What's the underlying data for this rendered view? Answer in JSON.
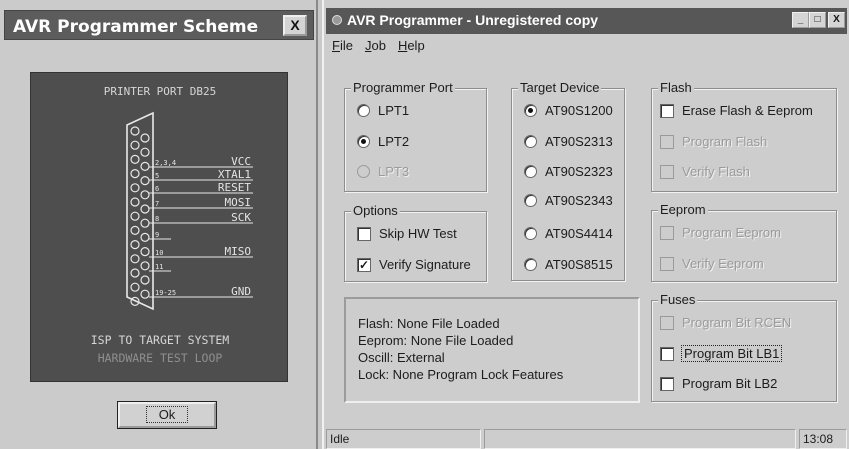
{
  "scheme_window": {
    "title": "AVR Programmer Scheme",
    "close_label": "X",
    "port_label": "PRINTER PORT DB25",
    "pin_labels": [
      {
        "num": "2,3,4",
        "name": "VCC"
      },
      {
        "num": "5",
        "name": "XTAL1"
      },
      {
        "num": "6",
        "name": "RESET"
      },
      {
        "num": "7",
        "name": "MOSI"
      },
      {
        "num": "8",
        "name": "SCK"
      },
      {
        "num": "9",
        "name": ""
      },
      {
        "num": "10",
        "name": "MISO"
      },
      {
        "num": "11",
        "name": ""
      },
      {
        "num": "19-25",
        "name": "GND"
      }
    ],
    "isp_label": "ISP TO TARGET SYSTEM",
    "hw_test_label": "HARDWARE TEST LOOP",
    "ok_label": "Ok"
  },
  "programmer_window": {
    "title": "AVR Programmer - Unregistered copy",
    "buttons": {
      "minimize": "_",
      "maximize": "□",
      "close": "X"
    },
    "menu": [
      "File",
      "Job",
      "Help"
    ],
    "programmer_port": {
      "label": "Programmer Port",
      "options": [
        {
          "label": "LPT1",
          "selected": false,
          "enabled": true
        },
        {
          "label": "LPT2",
          "selected": true,
          "enabled": true
        },
        {
          "label": "LPT3",
          "selected": false,
          "enabled": false
        }
      ]
    },
    "options": {
      "label": "Options",
      "items": [
        {
          "label": "Skip HW Test",
          "checked": false
        },
        {
          "label": "Verify Signature",
          "checked": true
        }
      ]
    },
    "target_device": {
      "label": "Target Device",
      "options": [
        {
          "label": "AT90S1200",
          "selected": true
        },
        {
          "label": "AT90S2313",
          "selected": false
        },
        {
          "label": "AT90S2323",
          "selected": false
        },
        {
          "label": "AT90S2343",
          "selected": false
        },
        {
          "label": "AT90S4414",
          "selected": false
        },
        {
          "label": "AT90S8515",
          "selected": false
        }
      ]
    },
    "flash": {
      "label": "Flash",
      "items": [
        {
          "label": "Erase Flash & Eeprom",
          "enabled": true
        },
        {
          "label": "Program Flash",
          "enabled": false
        },
        {
          "label": "Verify Flash",
          "enabled": false
        }
      ]
    },
    "eeprom": {
      "label": "Eeprom",
      "items": [
        {
          "label": "Program Eeprom",
          "enabled": false
        },
        {
          "label": "Verify Eeprom",
          "enabled": false
        }
      ]
    },
    "fuses": {
      "label": "Fuses",
      "items": [
        {
          "label": "Program Bit RCEN",
          "enabled": false
        },
        {
          "label": "Program Bit LB1",
          "enabled": true,
          "focused": true
        },
        {
          "label": "Program Bit LB2",
          "enabled": true
        }
      ]
    },
    "info": {
      "flash": "Flash: None File Loaded",
      "eeprom": "Eeprom: None File Loaded",
      "oscill": "Oscill: External",
      "lock": "Lock: None Program Lock Features"
    },
    "status": {
      "state": "Idle",
      "time": "13:08"
    }
  }
}
